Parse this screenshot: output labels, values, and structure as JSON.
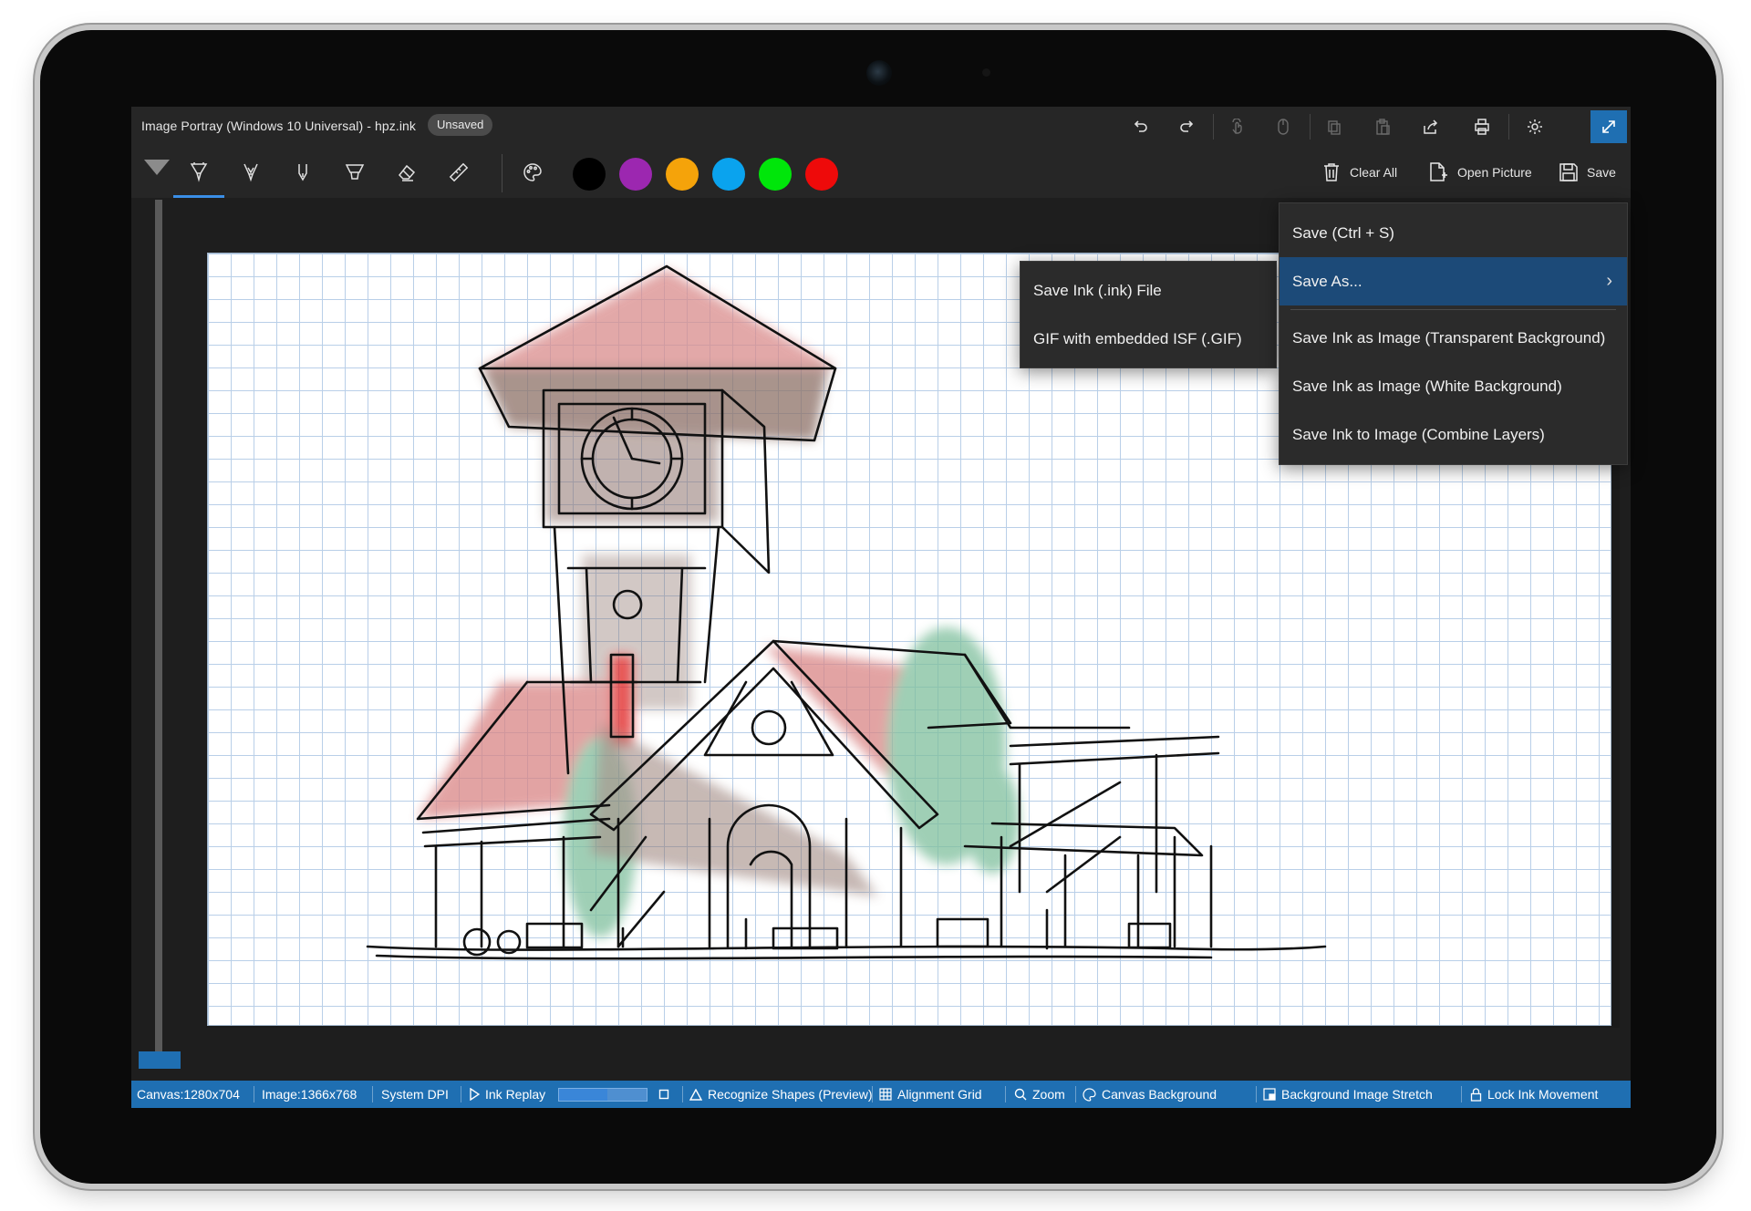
{
  "window": {
    "title": "Image Portray (Windows 10 Universal)  - hpz.ink",
    "status_badge": "Unsaved"
  },
  "titlebar_icons": [
    "undo-icon",
    "redo-icon",
    "touch-icon",
    "mouse-icon",
    "copy-icon",
    "paste-icon",
    "share-icon",
    "print-icon",
    "settings-icon",
    "fullscreen-icon"
  ],
  "toolbar": {
    "tools": [
      "pen-tool",
      "pencil-tool",
      "calligraphy-pen-tool",
      "highlighter-tool",
      "eraser-tool",
      "ruler-tool",
      "palette-tool"
    ],
    "colors": [
      "#000000",
      "#9c27b0",
      "#f5a30a",
      "#0aa3ee",
      "#00e60a",
      "#ee0a0a"
    ],
    "clear_all": "Clear All",
    "open_picture": "Open Picture",
    "save": "Save"
  },
  "save_menu": {
    "items": [
      {
        "label": "Save (Ctrl + S)"
      },
      {
        "label": "Save As...",
        "submenu": true
      },
      {
        "label": "Save Ink as Image (Transparent Background)"
      },
      {
        "label": "Save Ink as Image (White Background)"
      },
      {
        "label": "Save Ink to Image (Combine Layers)"
      }
    ]
  },
  "save_as_submenu": {
    "items": [
      {
        "label": "Save Ink (.ink) File"
      },
      {
        "label": "GIF with embedded ISF (.GIF)"
      }
    ]
  },
  "statusbar": {
    "canvas": "Canvas:1280x704",
    "image": "Image:1366x768",
    "dpi": "System DPI",
    "ink_replay": "Ink Replay",
    "ink_replay_progress": 0.55,
    "recognize_shapes": "Recognize Shapes (Preview)",
    "alignment_grid": "Alignment Grid",
    "zoom": "Zoom",
    "canvas_background": "Canvas Background",
    "background_image_stretch": "Background Image Stretch",
    "lock_ink_movement": "Lock Ink Movement"
  },
  "accent_color": "#1f6fb2"
}
